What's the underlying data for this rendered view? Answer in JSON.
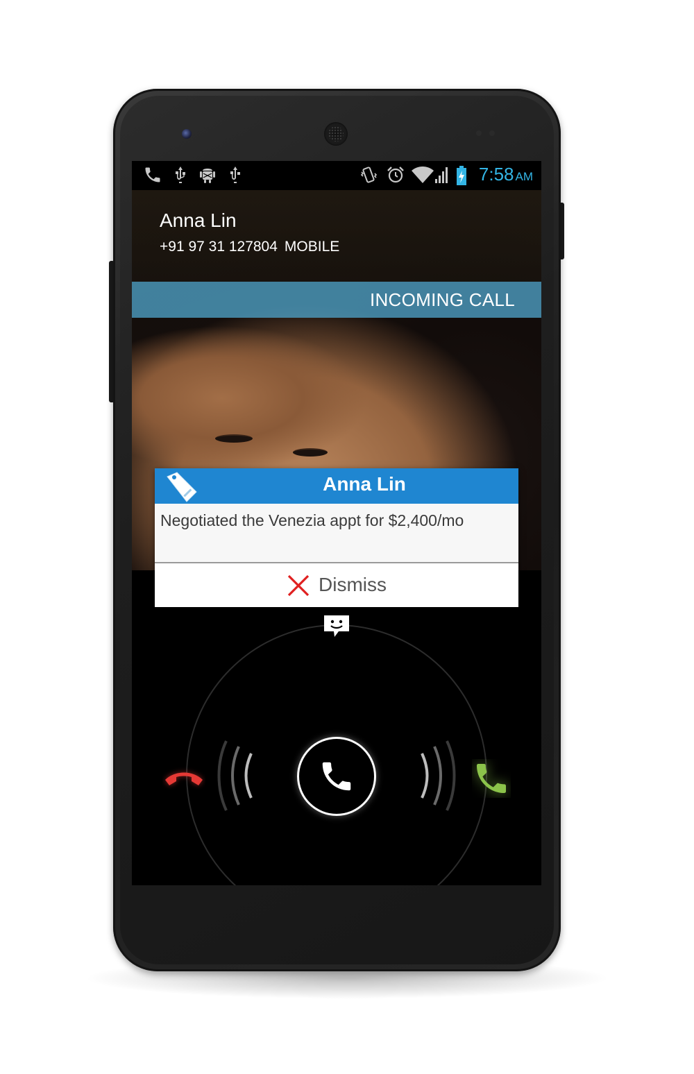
{
  "status_bar": {
    "time": "7:58",
    "ampm": "AM",
    "icons": [
      "phone-icon",
      "usb-icon",
      "android-debug-icon",
      "usb-icon",
      "vibrate-icon",
      "alarm-icon",
      "wifi-icon",
      "signal-icon",
      "battery-charging-icon"
    ],
    "time_color": "#33b5e5"
  },
  "caller": {
    "name": "Anna Lin",
    "number": "+91 97 31 127804",
    "number_label": "MOBILE"
  },
  "call_state": "INCOMING CALL",
  "note_card": {
    "title": "Anna Lin",
    "note": "Negotiated the Venezia appt for $2,400/mo",
    "dismiss_label": "Dismiss",
    "header_color": "#1f86d1",
    "dismiss_icon_color": "#e02020"
  },
  "answer_widget": {
    "targets": [
      "sms-reply-icon",
      "decline-call-icon",
      "answer-call-icon"
    ],
    "decline_color": "#e53935",
    "accept_color": "#8bc34a"
  }
}
